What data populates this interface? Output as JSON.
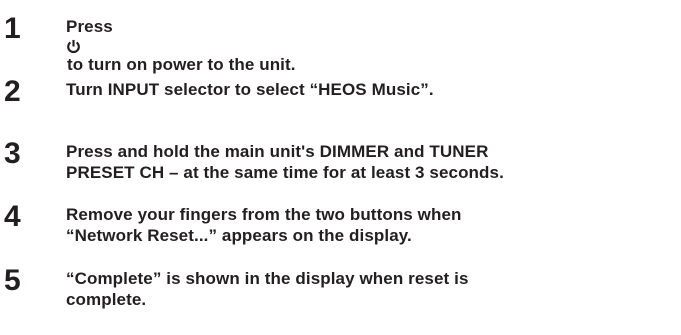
{
  "steps": [
    {
      "number": "1",
      "before_icon": "Press",
      "icon": "power-icon",
      "after_icon": "to turn on power to the unit."
    },
    {
      "number": "2",
      "text": "Turn INPUT selector to select “HEOS Music”."
    },
    {
      "number": "3",
      "line1": "Press and hold the main unit's DIMMER and TUNER",
      "line2": "PRESET CH – at the same time for at least 3 seconds."
    },
    {
      "number": "4",
      "line1": "Remove your fingers from the two buttons when",
      "line2": "“Network Reset...” appears on the display."
    },
    {
      "number": "5",
      "line1": "“Complete” is shown in the display when reset is",
      "line2": "complete."
    }
  ]
}
